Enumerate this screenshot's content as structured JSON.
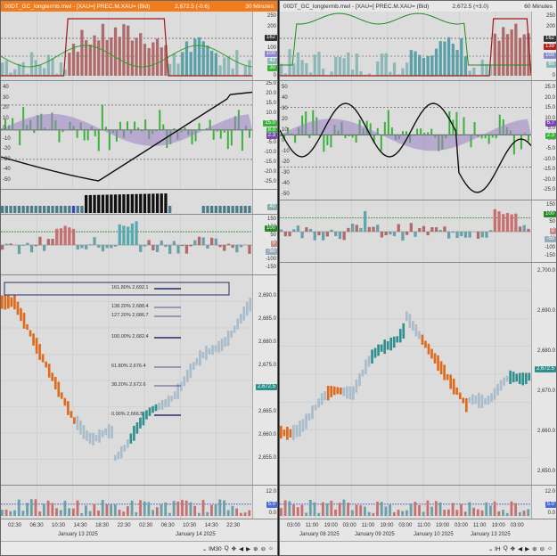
{
  "left": {
    "title": "00DT_GC_longtermb.mwl - [XAU=] PREC.M.XAU= (Bid)",
    "price": "2,672.5 (-0.6)",
    "timeframe": "30 Minutes",
    "title_color": "#f07c1e",
    "panes": {
      "p1": {
        "ticks": [
          "250",
          "200",
          "150",
          "100",
          "50",
          "0"
        ],
        "badges": [
          "162",
          "100",
          "42",
          "30"
        ]
      },
      "p2": {
        "ticks": [
          "25.0",
          "20.0",
          "15.0",
          "10.0",
          "5.0",
          "0.0",
          "-5.0",
          "-10.0",
          "-15.0",
          "-20.0",
          "-25.0"
        ],
        "left_ticks": [
          "40",
          "30",
          "20",
          "10",
          "0",
          "-10",
          "-20",
          "-30",
          "-40",
          "-50"
        ],
        "badges": [
          "15.0",
          "8.0",
          "2.3"
        ]
      },
      "p3": {
        "ticks": [
          "40"
        ]
      },
      "p4": {
        "ticks": [
          "150",
          "100",
          "50",
          "0",
          "-50",
          "-100",
          "-150"
        ],
        "badges": [
          "100",
          "0",
          "-50"
        ]
      },
      "p5": {
        "ticks": [
          "2,690.0",
          "2,685.0",
          "2,680.0",
          "2,675.0",
          "2,670.0",
          "2,665.0",
          "2,660.0",
          "2,655.0"
        ],
        "badges": [
          "2,672.5"
        ]
      },
      "p6": {
        "ticks": [
          "12.0",
          "5.0",
          "0.0"
        ],
        "badges": [
          "5.0"
        ]
      }
    },
    "fib_levels": [
      "161.80% 2,692.1",
      "138.20% 2,688.4",
      "127.20% 2,686.7",
      "100.00% 2,682.4",
      "61.80% 2,676.4",
      "38.20% 2,672.6",
      "0.00% 2,666.5"
    ],
    "xaxis_times": [
      "02:30",
      "06:30",
      "10:30",
      "14:30",
      "18:30",
      "22:30",
      "02:30",
      "06:30",
      "10:30",
      "14:30",
      "22:30"
    ],
    "xaxis_dates": [
      "January 13 2025",
      "January 14 2025"
    ],
    "footer_interval": "IM30"
  },
  "right": {
    "title": "00DT_GC_longtermb.mwl - [XAU=] PREC.M.XAU= (Bid)",
    "price": "2,672.5 (+3.0)",
    "timeframe": "60 Minutes",
    "title_color": "#e8e8e8",
    "panes": {
      "p1": {
        "ticks": [
          "250",
          "200",
          "150",
          "100",
          "50",
          "0"
        ],
        "badges": [
          "162",
          "139",
          "100",
          "60"
        ]
      },
      "p2": {
        "ticks": [
          "25.0",
          "20.0",
          "15.0",
          "10.0",
          "5.0",
          "0.0",
          "-5.0",
          "-10.0",
          "-15.0",
          "-20.0",
          "-25.0"
        ],
        "left_ticks": [
          "50",
          "40",
          "30",
          "20",
          "10",
          "0",
          "-10",
          "-20",
          "-30",
          "-40",
          "-50"
        ],
        "badges": [
          "6.7",
          "2.3"
        ]
      },
      "p4": {
        "ticks": [
          "150",
          "100",
          "50",
          "0",
          "-50",
          "-100",
          "-150"
        ],
        "badges": [
          "100",
          "0",
          "-50"
        ]
      },
      "p5": {
        "ticks": [
          "2,700.0",
          "2,690.0",
          "2,680.0",
          "2,670.0",
          "2,660.0",
          "2,650.0"
        ],
        "badges": [
          "2,672.5"
        ]
      },
      "p6": {
        "ticks": [
          "12.0",
          "5.0",
          "0.0"
        ],
        "badges": [
          "5.0"
        ]
      }
    },
    "xaxis_times": [
      "03:00",
      "11:00",
      "19:00",
      "03:00",
      "11:00",
      "19:00",
      "03:00",
      "11:00",
      "19:00",
      "03:00",
      "11:00",
      "19:00",
      "03:00"
    ],
    "xaxis_dates": [
      "January 08 2025",
      "January 09 2025",
      "January 10 2025",
      "January 13 2025"
    ],
    "footer_interval": "IH"
  },
  "colors": {
    "up": "#2f8f8f",
    "down": "#e06a1c",
    "neutral": "#a9bccb",
    "green": "#3cb23c",
    "red": "#b22020",
    "purple": "#9b7fc2"
  }
}
